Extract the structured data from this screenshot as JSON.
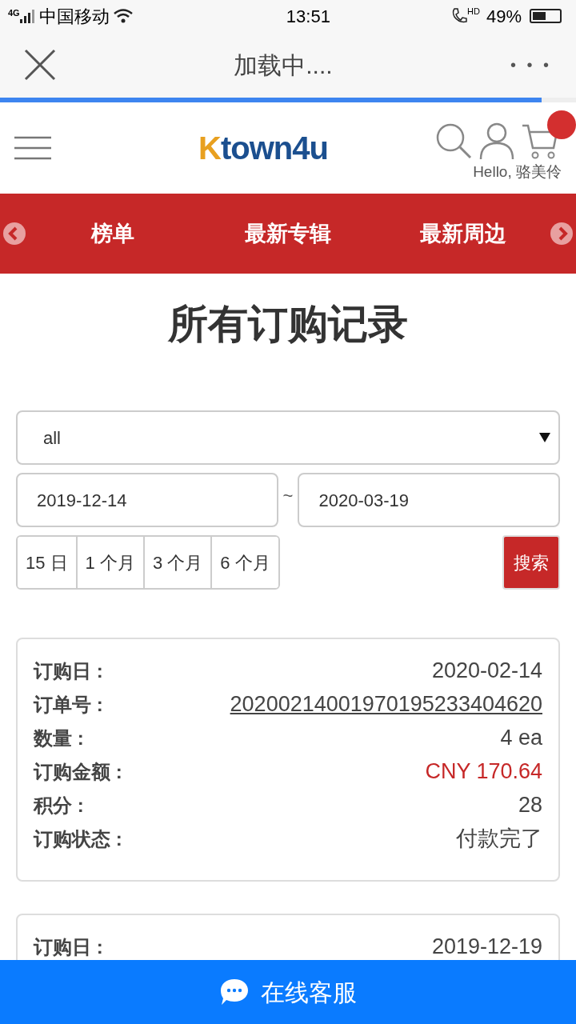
{
  "status_bar": {
    "network": "4G",
    "carrier": "中国移动",
    "time": "13:51",
    "call_badge": "HD",
    "battery": "49%"
  },
  "browser_bar": {
    "title": "加载中....",
    "more": "• • •",
    "progress": {
      "level": 0.94
    }
  },
  "header": {
    "logo": "Ktown4u",
    "greeting": "Hello, 骆美伶",
    "cart_badge": true
  },
  "nav": {
    "items": [
      "榜单",
      "最新专辑",
      "最新周边"
    ]
  },
  "page_title": "所有订购记录",
  "filters": {
    "status": "all",
    "date_from": "2019-12-14",
    "separator": "~",
    "date_to": "2020-03-19",
    "periods": [
      "15 日",
      "1 个月",
      "3 个月",
      "6 个月"
    ],
    "search_button": "搜索"
  },
  "orders": [
    {
      "rows": [
        {
          "label": "订购日 :",
          "value": "2020-02-14",
          "kind": "plain"
        },
        {
          "label": "订单号 :",
          "value": "20200214001970195233404620",
          "kind": "link"
        },
        {
          "label": "数量 :",
          "value": "4 ea",
          "kind": "plain"
        },
        {
          "label": "订购金额 :",
          "value": "CNY 170.64",
          "kind": "price"
        },
        {
          "label": "积分 :",
          "value": "28",
          "kind": "plain"
        },
        {
          "label": "订购状态 :",
          "value": "付款完了",
          "kind": "plain"
        }
      ]
    },
    {
      "rows": [
        {
          "label": "订购日 :",
          "value": "2019-12-19",
          "kind": "plain"
        }
      ]
    }
  ],
  "chat_button": "在线客服"
}
